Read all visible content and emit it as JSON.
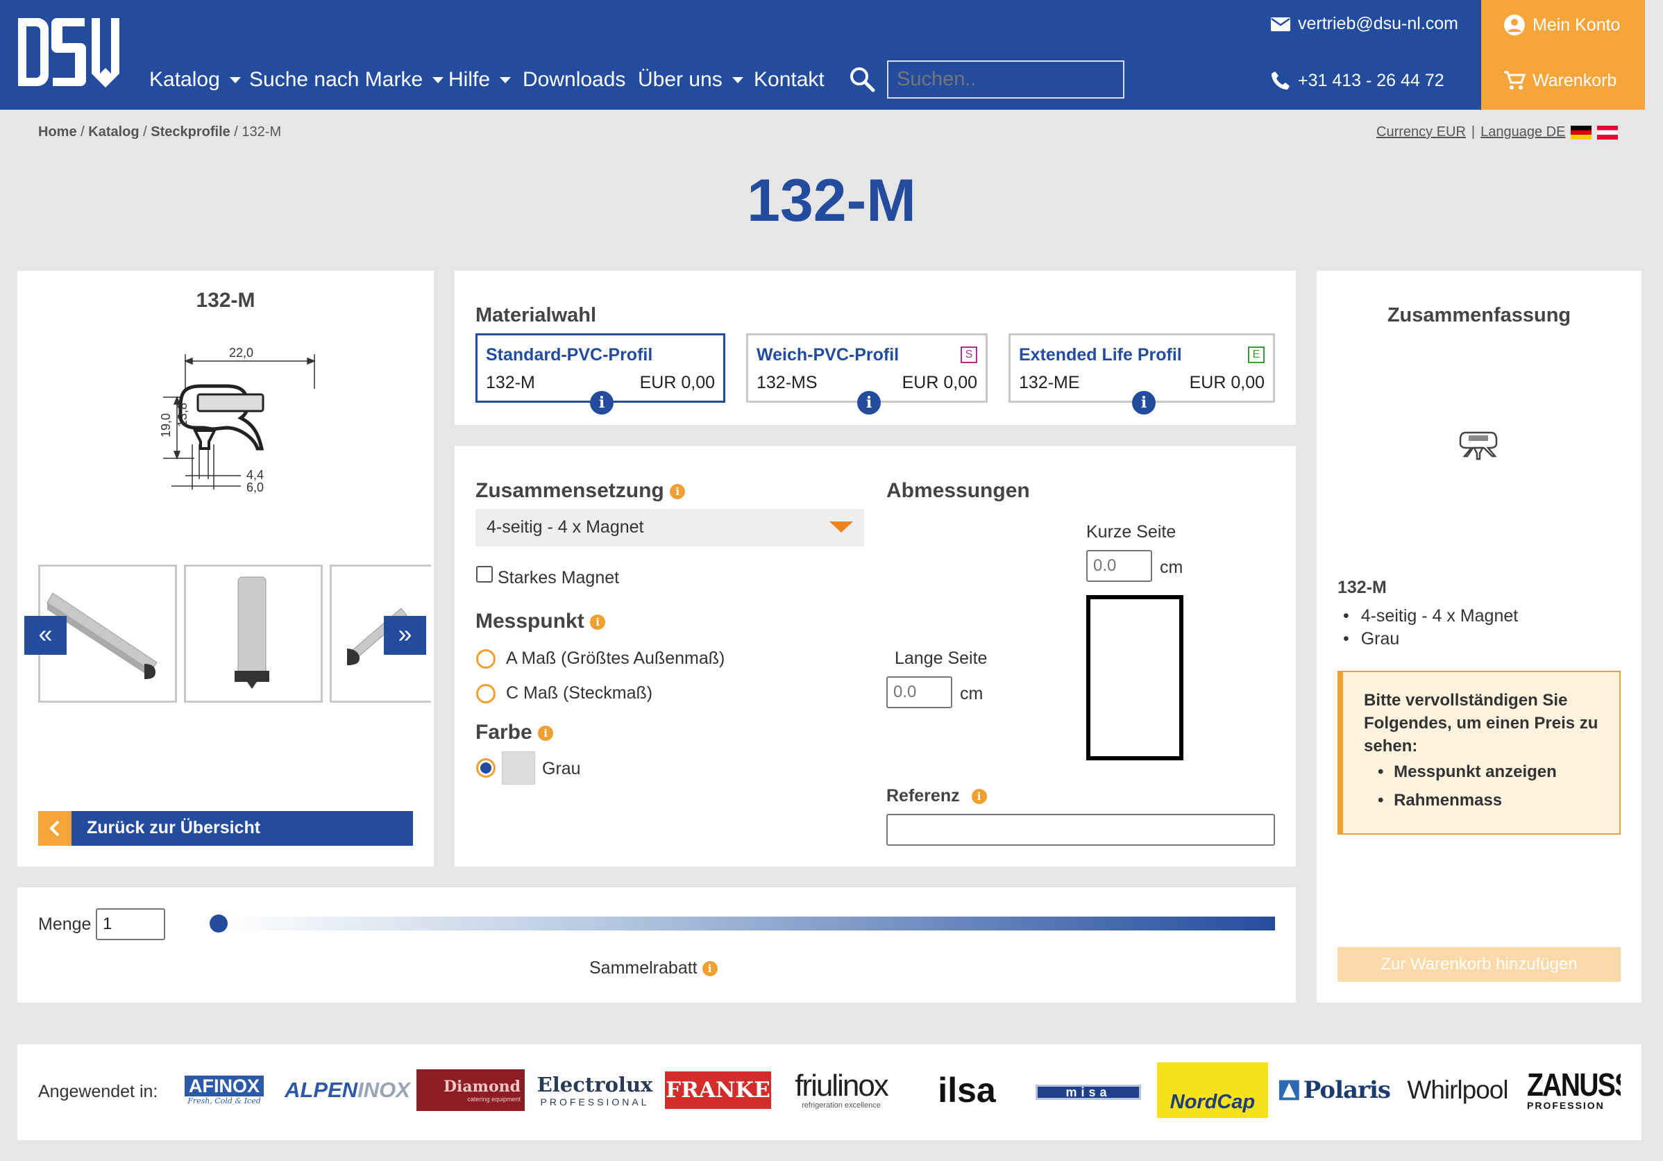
{
  "header": {
    "logo": "DSU",
    "nav": [
      {
        "label": "Katalog",
        "dropdown": true
      },
      {
        "label": "Suche nach Marke",
        "dropdown": true
      },
      {
        "label": "Hilfe",
        "dropdown": true
      },
      {
        "label": "Downloads",
        "dropdown": false
      },
      {
        "label": "Über uns",
        "dropdown": true
      },
      {
        "label": "Kontakt",
        "dropdown": false
      }
    ],
    "search_placeholder": "Suchen..",
    "email": "vertrieb@dsu-nl.com",
    "phone": "+31 413 - 26 44 72",
    "account": "Mein Konto",
    "cart": "Warenkorb",
    "brand_color": "#244c9e",
    "accent_color": "#f5a53a"
  },
  "breadcrumb": {
    "items": [
      "Home",
      "Katalog",
      "Steckprofile"
    ],
    "current": "132-M",
    "currency": "Currency EUR",
    "separator": "|",
    "language": "Language DE"
  },
  "page_title": "132-M",
  "product": {
    "title": "132-M",
    "dims": {
      "w": "22,0",
      "h1": "19,0",
      "h2": "13,8",
      "d1": "4,4",
      "d2": "6,0"
    },
    "prev": "«",
    "next": "»",
    "back": "Zurück zur Übersicht"
  },
  "material": {
    "title": "Materialwahl",
    "options": [
      {
        "name": "Standard-PVC-Profil",
        "code": "132-M",
        "price": "EUR 0,00",
        "badge": "",
        "selected": true
      },
      {
        "name": "Weich-PVC-Profil",
        "code": "132-MS",
        "price": "EUR 0,00",
        "badge": "S",
        "selected": false
      },
      {
        "name": "Extended Life Profil",
        "code": "132-ME",
        "price": "EUR 0,00",
        "badge": "E",
        "selected": false
      }
    ]
  },
  "config": {
    "composition_label": "Zusammensetzung",
    "composition_value": "4-seitig - 4 x Magnet",
    "strong_magnet": "Starkes Magnet",
    "measure_label": "Messpunkt",
    "measure_a": "A Maß (Größtes Außenmaß)",
    "measure_c": "C Maß (Steckmaß)",
    "color_label": "Farbe",
    "color_value": "Grau",
    "dim_label": "Abmessungen",
    "short_side": "Kurze Seite",
    "long_side": "Lange Seite",
    "short_value": "0.0",
    "long_value": "0.0",
    "unit": "cm",
    "reference_label": "Referenz"
  },
  "quantity": {
    "label": "Menge",
    "value": "1",
    "discount": "Sammelrabatt"
  },
  "summary": {
    "title": "Zusammenfassung",
    "product": "132-M",
    "items": [
      "4-seitig - 4 x Magnet",
      "Grau"
    ],
    "notice_title": "Bitte vervollständigen Sie Folgendes, um einen Preis zu sehen:",
    "notice_items": [
      "Messpunkt anzeigen",
      "Rahmenmass"
    ],
    "add_button": "Zur Warenkorb hinzufügen"
  },
  "brands": {
    "label": "Angewendet in:",
    "afinox": "AFINOX",
    "afinox_sub": "Fresh, Cold & Iced",
    "alpen_a": "ALPEN",
    "alpen_b": "INOX",
    "diamond": "Diamond",
    "diamond_sub": "catering equipment",
    "electrolux": "Electrolux",
    "electrolux_sub": "PROFESSIONAL",
    "franke": "FRANKE",
    "friulinox": "friulinox",
    "friulinox_sub": "refrigeration excellence",
    "ilsa": "ilsa",
    "misa": "misa",
    "nordcap": "NordCap",
    "polaris": "Polaris",
    "whirlpool": "Whirlpool",
    "zanussi": "ZANUSS",
    "zanussi_sub": "PROFESSION"
  }
}
